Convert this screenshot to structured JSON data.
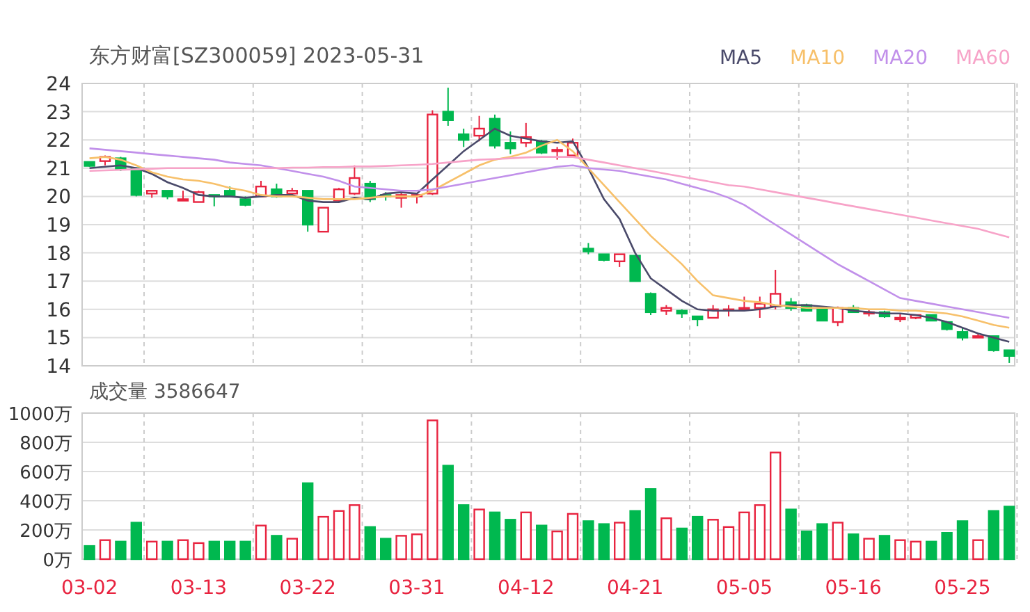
{
  "price_chart": {
    "chart_data": {
      "type": "candlestick",
      "title": "东方财富[SZ300059] 2023-05-31",
      "grid": true,
      "ylim": [
        14,
        24
      ],
      "yticks": [
        14,
        15,
        16,
        17,
        18,
        19,
        20,
        21,
        22,
        23,
        24
      ],
      "ohlc": [
        [
          21.22,
          21.22,
          21.05,
          21.08
        ],
        [
          21.25,
          21.45,
          21.1,
          21.4
        ],
        [
          21.35,
          21.4,
          20.9,
          20.95
        ],
        [
          21.0,
          21.0,
          20.0,
          20.05
        ],
        [
          20.1,
          20.2,
          19.95,
          20.2
        ],
        [
          20.2,
          20.2,
          19.9,
          20.0
        ],
        [
          19.85,
          20.2,
          19.85,
          19.9
        ],
        [
          19.8,
          20.2,
          19.8,
          20.15
        ],
        [
          20.05,
          20.05,
          19.65,
          20.0
        ],
        [
          20.2,
          20.35,
          20.0,
          20.0
        ],
        [
          19.9,
          20.0,
          19.65,
          19.7
        ],
        [
          20.0,
          20.55,
          20.0,
          20.35
        ],
        [
          20.25,
          20.45,
          19.95,
          20.0
        ],
        [
          20.1,
          20.3,
          20.0,
          20.2
        ],
        [
          20.2,
          20.2,
          18.75,
          19.0
        ],
        [
          18.75,
          19.6,
          18.75,
          19.6
        ],
        [
          19.85,
          20.3,
          19.8,
          20.25
        ],
        [
          20.1,
          21.1,
          20.05,
          20.65
        ],
        [
          20.45,
          20.55,
          19.8,
          19.9
        ],
        [
          20.05,
          20.15,
          19.85,
          20.0
        ],
        [
          19.95,
          20.15,
          19.6,
          20.05
        ],
        [
          20.0,
          20.1,
          19.75,
          20.05
        ],
        [
          20.1,
          23.05,
          20.05,
          22.9
        ],
        [
          23.0,
          23.85,
          22.5,
          22.7
        ],
        [
          22.2,
          22.4,
          21.75,
          22.0
        ],
        [
          22.15,
          22.85,
          21.95,
          22.4
        ],
        [
          22.75,
          22.9,
          21.7,
          21.8
        ],
        [
          21.9,
          22.3,
          21.5,
          21.7
        ],
        [
          21.9,
          22.6,
          21.75,
          22.1
        ],
        [
          21.95,
          22.0,
          21.5,
          21.55
        ],
        [
          21.6,
          21.75,
          21.3,
          21.65
        ],
        [
          21.45,
          22.05,
          21.45,
          21.9
        ],
        [
          18.15,
          18.35,
          17.95,
          18.05
        ],
        [
          17.95,
          17.95,
          17.7,
          17.75
        ],
        [
          17.7,
          17.95,
          17.5,
          17.95
        ],
        [
          17.9,
          17.9,
          17.0,
          17.0
        ],
        [
          16.55,
          16.6,
          15.8,
          15.9
        ],
        [
          15.95,
          16.15,
          15.8,
          16.05
        ],
        [
          15.95,
          16.0,
          15.7,
          15.85
        ],
        [
          15.75,
          15.75,
          15.4,
          15.65
        ],
        [
          15.7,
          16.15,
          15.7,
          16.0
        ],
        [
          15.95,
          16.15,
          15.75,
          16.0
        ],
        [
          16.0,
          16.45,
          15.95,
          16.05
        ],
        [
          16.05,
          16.45,
          15.7,
          16.2
        ],
        [
          16.1,
          17.4,
          16.0,
          16.55
        ],
        [
          16.25,
          16.4,
          15.95,
          16.05
        ],
        [
          16.15,
          16.2,
          15.95,
          15.95
        ],
        [
          16.05,
          16.05,
          15.6,
          15.6
        ],
        [
          15.55,
          16.1,
          15.4,
          16.05
        ],
        [
          16.05,
          16.15,
          15.9,
          15.9
        ],
        [
          15.85,
          16.0,
          15.75,
          15.9
        ],
        [
          15.9,
          15.95,
          15.7,
          15.75
        ],
        [
          15.65,
          15.85,
          15.55,
          15.7
        ],
        [
          15.7,
          15.8,
          15.65,
          15.8
        ],
        [
          15.8,
          15.8,
          15.6,
          15.6
        ],
        [
          15.55,
          15.55,
          15.25,
          15.3
        ],
        [
          15.2,
          15.35,
          14.9,
          15.0
        ],
        [
          15.0,
          15.15,
          15.0,
          15.05
        ],
        [
          15.05,
          15.05,
          14.5,
          14.55
        ],
        [
          14.55,
          14.55,
          14.1,
          14.35
        ]
      ]
    }
  },
  "moving_averages": {
    "chart_data": {
      "type": "line",
      "ylim": [
        14,
        24
      ],
      "series": [
        {
          "name": "MA5",
          "color": "#4a4a6a",
          "values": [
            21.0,
            21.05,
            21.1,
            21.0,
            20.8,
            20.5,
            20.3,
            20.05,
            20.0,
            20.0,
            19.95,
            20.0,
            20.05,
            20.05,
            19.85,
            19.8,
            19.8,
            19.95,
            19.9,
            20.1,
            20.15,
            20.1,
            20.6,
            21.1,
            21.6,
            22.0,
            22.4,
            22.15,
            22.05,
            21.95,
            21.9,
            21.95,
            21.0,
            19.9,
            19.2,
            18.0,
            17.1,
            16.7,
            16.3,
            16.0,
            15.95,
            15.95,
            15.95,
            16.0,
            16.1,
            16.15,
            16.15,
            16.1,
            16.05,
            15.95,
            15.9,
            15.85,
            15.85,
            15.8,
            15.7,
            15.55,
            15.35,
            15.15,
            15.0,
            14.85
          ]
        },
        {
          "name": "MA10",
          "color": "#f7c06a",
          "values": [
            21.35,
            21.4,
            21.3,
            21.1,
            20.85,
            20.7,
            20.6,
            20.55,
            20.45,
            20.3,
            20.2,
            20.05,
            20.0,
            20.0,
            19.95,
            19.9,
            19.9,
            19.9,
            19.95,
            20.0,
            20.0,
            20.0,
            20.2,
            20.5,
            20.8,
            21.1,
            21.3,
            21.4,
            21.55,
            21.8,
            22.0,
            21.6,
            21.0,
            20.4,
            19.8,
            19.2,
            18.6,
            18.1,
            17.6,
            17.0,
            16.5,
            16.4,
            16.3,
            16.25,
            16.15,
            16.1,
            16.05,
            16.05,
            16.05,
            16.05,
            16.0,
            16.0,
            15.95,
            15.95,
            15.9,
            15.85,
            15.75,
            15.6,
            15.45,
            15.35
          ]
        },
        {
          "name": "MA20",
          "color": "#c190ea",
          "values": [
            21.7,
            21.65,
            21.6,
            21.55,
            21.5,
            21.45,
            21.4,
            21.35,
            21.3,
            21.2,
            21.15,
            21.1,
            21.0,
            20.9,
            20.8,
            20.7,
            20.55,
            20.35,
            20.3,
            20.25,
            20.2,
            20.2,
            20.25,
            20.35,
            20.45,
            20.55,
            20.65,
            20.75,
            20.85,
            20.95,
            21.05,
            21.1,
            21.0,
            20.95,
            20.9,
            20.8,
            20.7,
            20.6,
            20.45,
            20.3,
            20.15,
            19.95,
            19.7,
            19.35,
            19.0,
            18.65,
            18.3,
            17.95,
            17.6,
            17.3,
            17.0,
            16.7,
            16.4,
            16.3,
            16.2,
            16.1,
            16.0,
            15.9,
            15.8,
            15.7
          ]
        },
        {
          "name": "MA60",
          "color": "#f7a3c8",
          "values": [
            20.9,
            20.92,
            20.94,
            20.96,
            20.98,
            21.0,
            21.0,
            21.0,
            21.0,
            21.0,
            21.0,
            21.0,
            21.0,
            21.02,
            21.02,
            21.04,
            21.04,
            21.06,
            21.06,
            21.08,
            21.1,
            21.12,
            21.15,
            21.2,
            21.25,
            21.3,
            21.32,
            21.35,
            21.38,
            21.4,
            21.4,
            21.4,
            21.3,
            21.2,
            21.1,
            21.0,
            20.9,
            20.8,
            20.7,
            20.6,
            20.5,
            20.4,
            20.35,
            20.25,
            20.15,
            20.05,
            19.95,
            19.85,
            19.75,
            19.65,
            19.55,
            19.45,
            19.35,
            19.25,
            19.15,
            19.05,
            18.95,
            18.85,
            18.7,
            18.55
          ]
        }
      ]
    }
  },
  "volume_chart": {
    "chart_data": {
      "type": "bar",
      "title": "成交量 3586647",
      "grid": true,
      "ylim": [
        0,
        1000
      ],
      "yticks": [
        {
          "value": 0,
          "label": "0万"
        },
        {
          "value": 200,
          "label": "200万"
        },
        {
          "value": 400,
          "label": "400万"
        },
        {
          "value": 600,
          "label": "600万"
        },
        {
          "value": 800,
          "label": "800万"
        },
        {
          "value": 1000,
          "label": "1000万"
        }
      ],
      "categories": [
        "03-02",
        null,
        null,
        null,
        null,
        null,
        null,
        "03-13",
        null,
        null,
        null,
        null,
        null,
        null,
        "03-22",
        null,
        null,
        null,
        null,
        null,
        null,
        "03-31",
        null,
        null,
        null,
        null,
        null,
        null,
        "04-12",
        null,
        null,
        null,
        null,
        null,
        null,
        "04-21",
        null,
        null,
        null,
        null,
        null,
        null,
        "05-05",
        null,
        null,
        null,
        null,
        null,
        null,
        "05-16",
        null,
        null,
        null,
        null,
        null,
        null,
        "05-25",
        null,
        null,
        null
      ],
      "values": [
        90,
        130,
        120,
        250,
        120,
        120,
        130,
        110,
        120,
        120,
        120,
        230,
        160,
        140,
        520,
        290,
        330,
        370,
        220,
        140,
        160,
        170,
        950,
        640,
        370,
        340,
        320,
        270,
        320,
        230,
        190,
        310,
        260,
        240,
        250,
        330,
        480,
        280,
        210,
        290,
        270,
        220,
        320,
        370,
        730,
        340,
        190,
        240,
        250,
        170,
        140,
        160,
        130,
        120,
        120,
        180,
        260,
        130,
        330,
        360
      ]
    }
  }
}
